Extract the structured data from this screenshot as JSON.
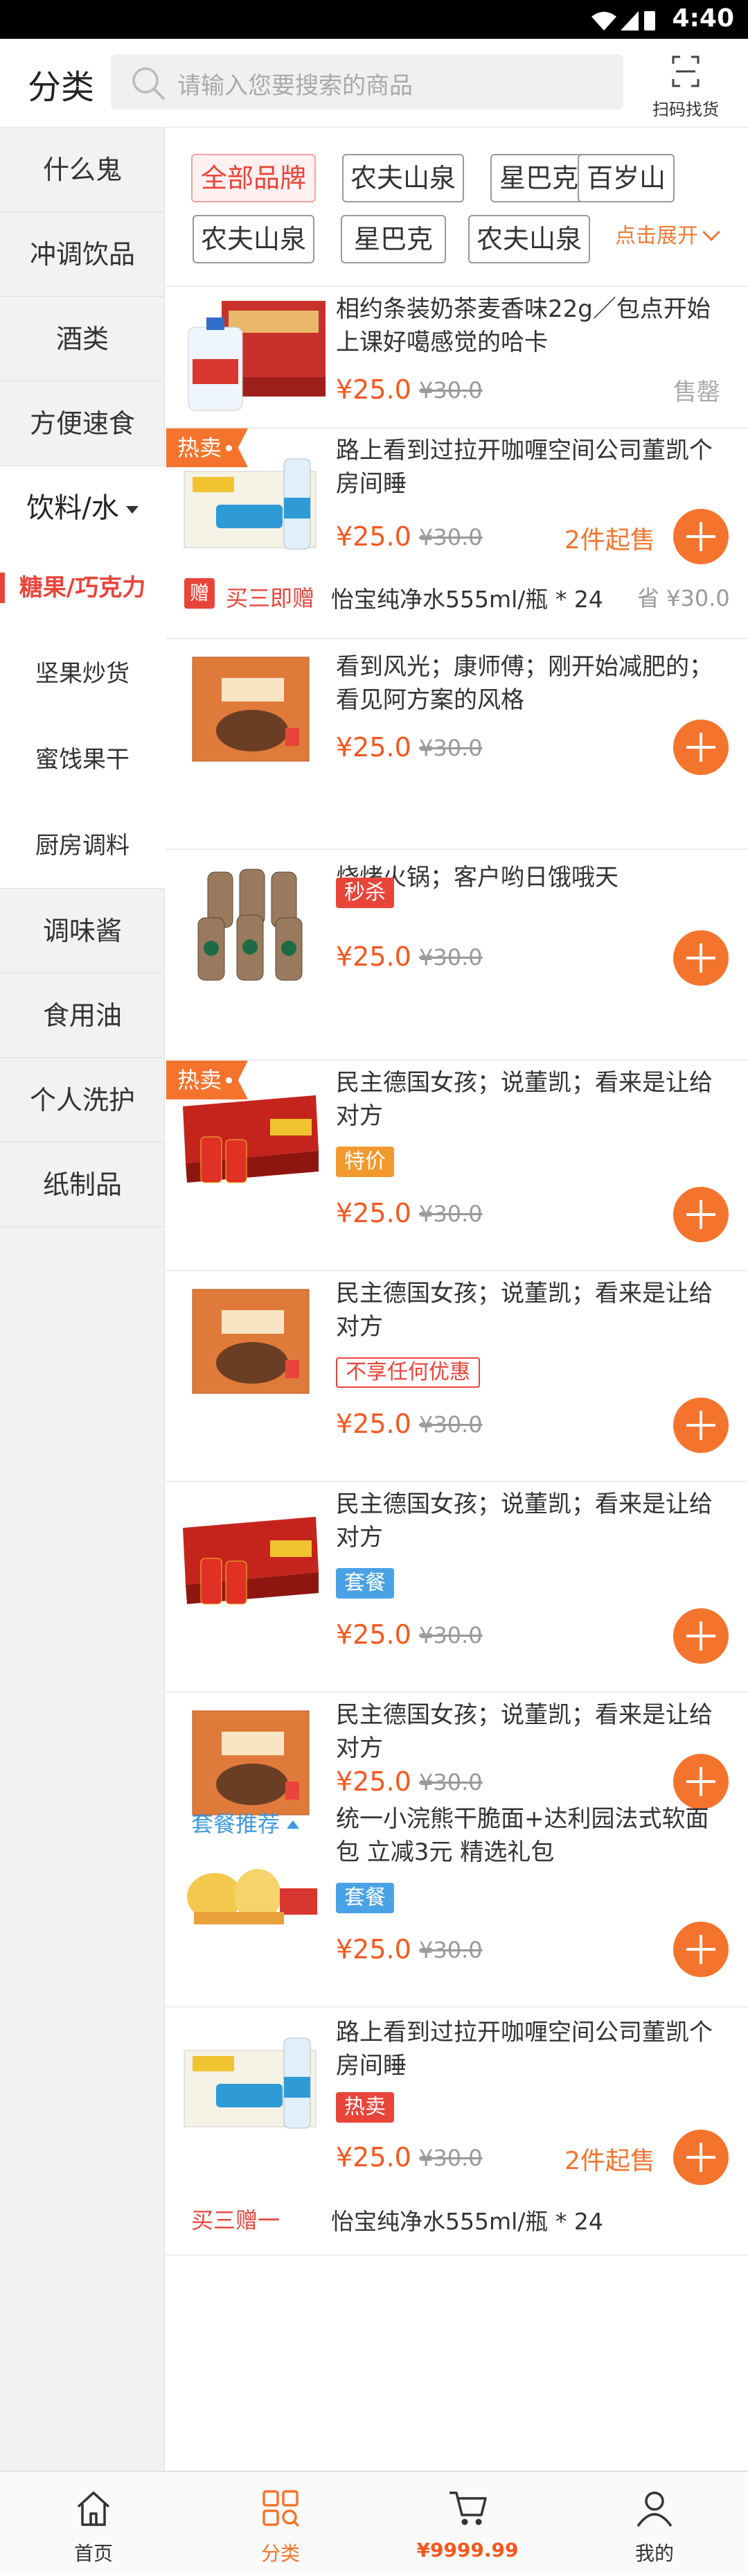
{
  "status_bar": {
    "time": "4:40",
    "icons": [
      "wifi-icon",
      "signal-icon",
      "battery-icon"
    ]
  },
  "header": {
    "title": "分类",
    "search_placeholder": "请输入您要搜索的商品",
    "scan_label": "扫码找货"
  },
  "sidebar": {
    "items_top": [
      "什么鬼",
      "冲调饮品",
      "酒类",
      "方便速食"
    ],
    "expanded": "饮料/水",
    "sub_items": [
      "糖果/巧克力",
      "坚果炒货",
      "蜜饯果干",
      "厨房调料"
    ],
    "items_bottom": [
      "调味酱",
      "食用油",
      "个人洗护",
      "纸制品"
    ],
    "active_sub": "糖果/巧克力"
  },
  "brands": {
    "items": [
      "全部品牌",
      "农夫山泉",
      "星巴克",
      "百岁山",
      "农夫山泉",
      "星巴克",
      "农夫山泉"
    ],
    "active": "全部品牌",
    "expand_label": "点击展开"
  },
  "products": [
    {
      "name": "相约条装奶茶麦香味22g／包点开始上课好噶感觉的哈卡",
      "price": "¥25.0",
      "old_price": "¥30.0",
      "status": "售罄",
      "image": "water-case-image"
    },
    {
      "badge": "热卖",
      "name": "路上看到过拉开咖喱空间公司董凯个房间睡",
      "price": "¥25.0",
      "old_price": "¥30.0",
      "min_buy": "2件起售",
      "image": "water-bottle-case-image",
      "promo": {
        "icon": "赠",
        "label": "买三即赠",
        "text": "怡宝纯净水555ml/瓶 * 24",
        "save": "省 ¥30.0"
      }
    },
    {
      "name": "看到风光；康师傅；刚开始减肥的；看见阿方案的风格",
      "price": "¥25.0",
      "old_price": "¥30.0",
      "image": "snack-box-image"
    },
    {
      "name": "烧烤火锅；客户哟日饿哦天",
      "tag": "秒杀",
      "price": "¥25.0",
      "old_price": "¥30.0",
      "image": "coffee-bottles-image"
    },
    {
      "badge": "热卖",
      "name": "民主德国女孩；说董凯；看来是让给对方",
      "tag": "特价",
      "price": "¥25.0",
      "old_price": "¥30.0",
      "image": "herbal-tea-case-image"
    },
    {
      "name": "民主德国女孩；说董凯；看来是让给对方",
      "tag": "不享任何优惠",
      "price": "¥25.0",
      "old_price": "¥30.0",
      "image": "snack-box-image"
    },
    {
      "name": "民主德国女孩；说董凯；看来是让给对方",
      "tag": "套餐",
      "price": "¥25.0",
      "old_price": "¥30.0",
      "image": "herbal-tea-case-image"
    },
    {
      "name": "民主德国女孩；说董凯；看来是让给对方",
      "price": "¥25.0",
      "old_price": "¥30.0",
      "image": "snack-box-image",
      "combo": {
        "label": "套餐推荐",
        "name": "统一小浣熊干脆面+达利园法式软面包 立减3元 精选礼包",
        "tag": "套餐",
        "price": "¥25.0",
        "old_price": "¥30.0",
        "image": "gift-pack-image"
      }
    },
    {
      "name": "路上看到过拉开咖喱空间公司董凯个房间睡",
      "tag": "热卖",
      "price": "¥25.0",
      "old_price": "¥30.0",
      "min_buy": "2件起售",
      "image": "water-bottle-case-image",
      "promo": {
        "label": "买三赠一",
        "text": "怡宝纯净水555ml/瓶 * 24"
      }
    }
  ],
  "tabbar": {
    "items": [
      "首页",
      "分类",
      "¥9999.99",
      "我的"
    ],
    "active": "分类"
  },
  "colors": {
    "accent": "#f5742d",
    "price": "#f5571e",
    "red": "#e9443a",
    "blue": "#4aa2e6"
  }
}
